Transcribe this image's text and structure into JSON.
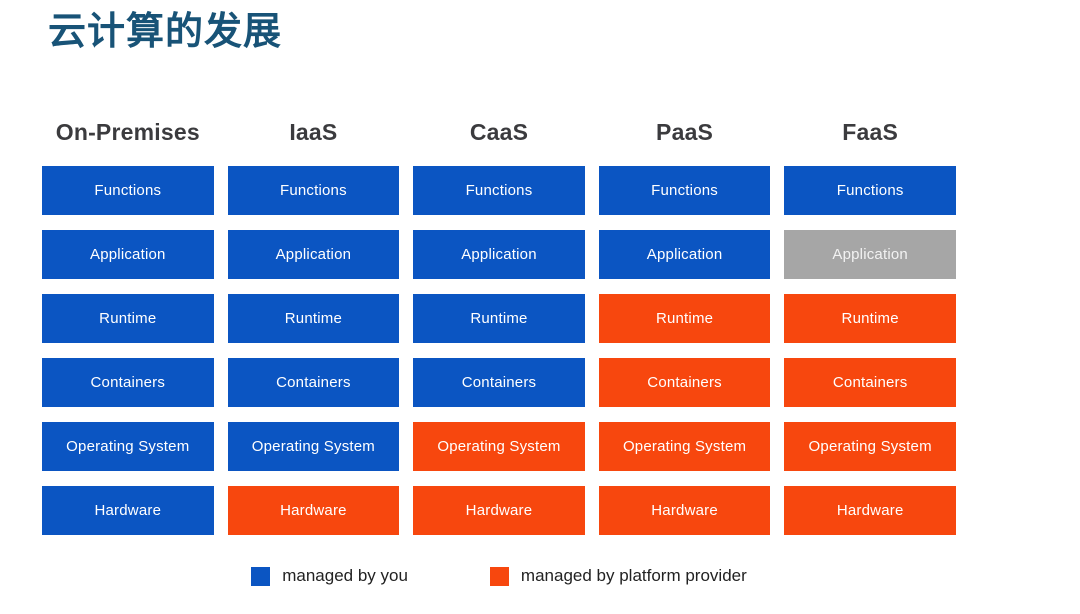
{
  "slide": {
    "title": "云计算的发展",
    "title_color": "#185377",
    "background": "#ffffff"
  },
  "palette": {
    "managed_by_you": "#0b55c2",
    "managed_by_platform_provider": "#f7470e",
    "not_applicable": "#a6a6a6",
    "header_text": "#3b3b3e",
    "cell_text": "#ffffff"
  },
  "matrix": {
    "columns": [
      {
        "label": "On-Premises"
      },
      {
        "label": "IaaS"
      },
      {
        "label": "CaaS"
      },
      {
        "label": "PaaS"
      },
      {
        "label": "FaaS"
      }
    ],
    "row_labels": [
      "Functions",
      "Application",
      "Runtime",
      "Containers",
      "Operating System",
      "Hardware"
    ],
    "rows": [
      {
        "name": "Functions",
        "cells": [
          {
            "label": "Functions",
            "state": "blue"
          },
          {
            "label": "Functions",
            "state": "blue"
          },
          {
            "label": "Functions",
            "state": "blue"
          },
          {
            "label": "Functions",
            "state": "blue"
          },
          {
            "label": "Functions",
            "state": "blue"
          }
        ]
      },
      {
        "name": "Application",
        "cells": [
          {
            "label": "Application",
            "state": "blue"
          },
          {
            "label": "Application",
            "state": "blue"
          },
          {
            "label": "Application",
            "state": "blue"
          },
          {
            "label": "Application",
            "state": "blue"
          },
          {
            "label": "Application",
            "state": "grey"
          }
        ]
      },
      {
        "name": "Runtime",
        "cells": [
          {
            "label": "Runtime",
            "state": "blue"
          },
          {
            "label": "Runtime",
            "state": "blue"
          },
          {
            "label": "Runtime",
            "state": "blue"
          },
          {
            "label": "Runtime",
            "state": "orange"
          },
          {
            "label": "Runtime",
            "state": "orange"
          }
        ]
      },
      {
        "name": "Containers",
        "cells": [
          {
            "label": "Containers",
            "state": "blue"
          },
          {
            "label": "Containers",
            "state": "blue"
          },
          {
            "label": "Containers",
            "state": "blue"
          },
          {
            "label": "Containers",
            "state": "orange"
          },
          {
            "label": "Containers",
            "state": "orange"
          }
        ]
      },
      {
        "name": "Operating System",
        "cells": [
          {
            "label": "Operating System",
            "state": "blue"
          },
          {
            "label": "Operating System",
            "state": "blue"
          },
          {
            "label": "Operating System",
            "state": "orange"
          },
          {
            "label": "Operating System",
            "state": "orange"
          },
          {
            "label": "Operating System",
            "state": "orange"
          }
        ]
      },
      {
        "name": "Hardware",
        "cells": [
          {
            "label": "Hardware",
            "state": "blue"
          },
          {
            "label": "Hardware",
            "state": "orange"
          },
          {
            "label": "Hardware",
            "state": "orange"
          },
          {
            "label": "Hardware",
            "state": "orange"
          },
          {
            "label": "Hardware",
            "state": "orange"
          }
        ]
      }
    ]
  },
  "legend": {
    "items": [
      {
        "label": "managed by you",
        "state": "blue"
      },
      {
        "label": "managed by platform provider",
        "state": "orange"
      }
    ]
  }
}
